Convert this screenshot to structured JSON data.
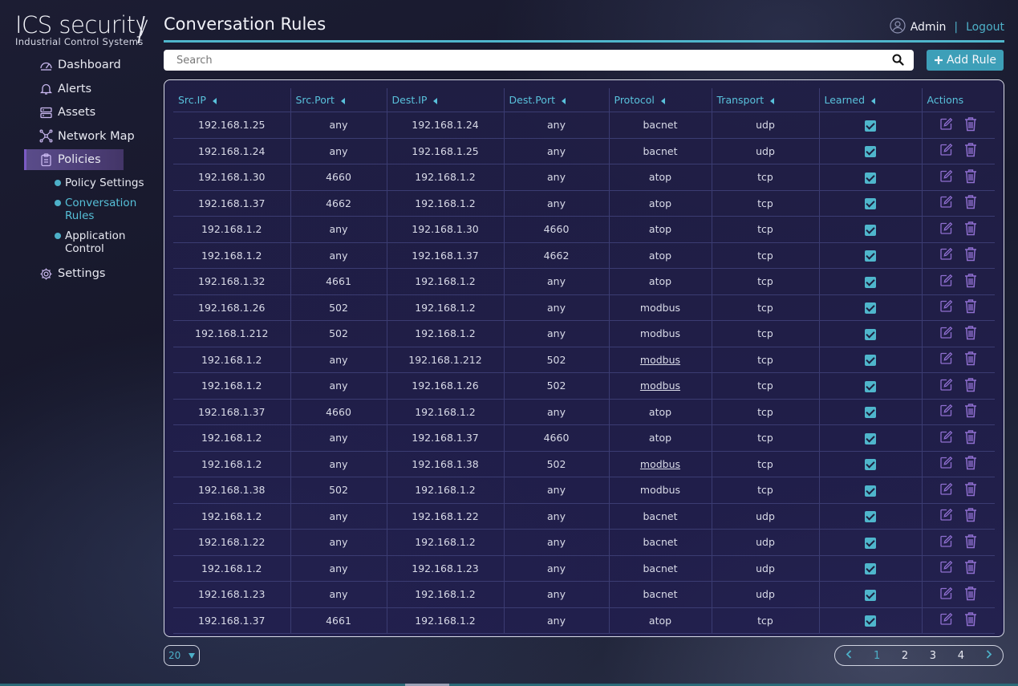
{
  "brand": {
    "name": "ICS security",
    "tagline": "Industrial Control Systems"
  },
  "sidebar": {
    "items": [
      {
        "label": "Dashboard",
        "icon": "dashboard-icon"
      },
      {
        "label": "Alerts",
        "icon": "bell-icon"
      },
      {
        "label": "Assets",
        "icon": "server-icon"
      },
      {
        "label": "Network Map",
        "icon": "network-icon"
      },
      {
        "label": "Policies",
        "icon": "clipboard-icon",
        "active": true
      },
      {
        "label": "Settings",
        "icon": "gear-icon"
      }
    ],
    "policy_subitems": [
      {
        "label": "Policy Settings"
      },
      {
        "label": "Conversation Rules",
        "active": true
      },
      {
        "label": "Application Control"
      }
    ]
  },
  "header": {
    "title": "Conversation Rules",
    "user": "Admin",
    "separator": "|",
    "logout": "Logout"
  },
  "search": {
    "placeholder": "Search"
  },
  "toolbar": {
    "add_label": "Add Rule"
  },
  "table": {
    "columns": [
      "Src.IP",
      "Src.Port",
      "Dest.IP",
      "Dest.Port",
      "Protocol",
      "Transport",
      "Learned",
      "Actions"
    ],
    "rows": [
      {
        "src_ip": "192.168.1.25",
        "src_port": "any",
        "dest_ip": "192.168.1.24",
        "dest_port": "any",
        "protocol": "bacnet",
        "transport": "udp",
        "learned": true
      },
      {
        "src_ip": "192.168.1.24",
        "src_port": "any",
        "dest_ip": "192.168.1.25",
        "dest_port": "any",
        "protocol": "bacnet",
        "transport": "udp",
        "learned": true
      },
      {
        "src_ip": "192.168.1.30",
        "src_port": "4660",
        "dest_ip": "192.168.1.2",
        "dest_port": "any",
        "protocol": "atop",
        "transport": "tcp",
        "learned": true
      },
      {
        "src_ip": "192.168.1.37",
        "src_port": "4662",
        "dest_ip": "192.168.1.2",
        "dest_port": "any",
        "protocol": "atop",
        "transport": "tcp",
        "learned": true
      },
      {
        "src_ip": "192.168.1.2",
        "src_port": "any",
        "dest_ip": "192.168.1.30",
        "dest_port": "4660",
        "protocol": "atop",
        "transport": "tcp",
        "learned": true
      },
      {
        "src_ip": "192.168.1.2",
        "src_port": "any",
        "dest_ip": "192.168.1.37",
        "dest_port": "4662",
        "protocol": "atop",
        "transport": "tcp",
        "learned": true
      },
      {
        "src_ip": "192.168.1.32",
        "src_port": "4661",
        "dest_ip": "192.168.1.2",
        "dest_port": "any",
        "protocol": "atop",
        "transport": "tcp",
        "learned": true
      },
      {
        "src_ip": "192.168.1.26",
        "src_port": "502",
        "dest_ip": "192.168.1.2",
        "dest_port": "any",
        "protocol": "modbus",
        "transport": "tcp",
        "learned": true
      },
      {
        "src_ip": "192.168.1.212",
        "src_port": "502",
        "dest_ip": "192.168.1.2",
        "dest_port": "any",
        "protocol": "modbus",
        "transport": "tcp",
        "learned": true
      },
      {
        "src_ip": "192.168.1.2",
        "src_port": "any",
        "dest_ip": "192.168.1.212",
        "dest_port": "502",
        "protocol": "modbus",
        "protocol_link": true,
        "transport": "tcp",
        "learned": true
      },
      {
        "src_ip": "192.168.1.2",
        "src_port": "any",
        "dest_ip": "192.168.1.26",
        "dest_port": "502",
        "protocol": "modbus",
        "protocol_link": true,
        "transport": "tcp",
        "learned": true
      },
      {
        "src_ip": "192.168.1.37",
        "src_port": "4660",
        "dest_ip": "192.168.1.2",
        "dest_port": "any",
        "protocol": "atop",
        "transport": "tcp",
        "learned": true
      },
      {
        "src_ip": "192.168.1.2",
        "src_port": "any",
        "dest_ip": "192.168.1.37",
        "dest_port": "4660",
        "protocol": "atop",
        "transport": "tcp",
        "learned": true
      },
      {
        "src_ip": "192.168.1.2",
        "src_port": "any",
        "dest_ip": "192.168.1.38",
        "dest_port": "502",
        "protocol": "modbus",
        "protocol_link": true,
        "transport": "tcp",
        "learned": true
      },
      {
        "src_ip": "192.168.1.38",
        "src_port": "502",
        "dest_ip": "192.168.1.2",
        "dest_port": "any",
        "protocol": "modbus",
        "transport": "tcp",
        "learned": true
      },
      {
        "src_ip": "192.168.1.2",
        "src_port": "any",
        "dest_ip": "192.168.1.22",
        "dest_port": "any",
        "protocol": "bacnet",
        "transport": "udp",
        "learned": true
      },
      {
        "src_ip": "192.168.1.22",
        "src_port": "any",
        "dest_ip": "192.168.1.2",
        "dest_port": "any",
        "protocol": "bacnet",
        "transport": "udp",
        "learned": true
      },
      {
        "src_ip": "192.168.1.2",
        "src_port": "any",
        "dest_ip": "192.168.1.23",
        "dest_port": "any",
        "protocol": "bacnet",
        "transport": "udp",
        "learned": true
      },
      {
        "src_ip": "192.168.1.23",
        "src_port": "any",
        "dest_ip": "192.168.1.2",
        "dest_port": "any",
        "protocol": "bacnet",
        "transport": "udp",
        "learned": true
      },
      {
        "src_ip": "192.168.1.37",
        "src_port": "4661",
        "dest_ip": "192.168.1.2",
        "dest_port": "any",
        "protocol": "atop",
        "transport": "tcp",
        "learned": true
      }
    ]
  },
  "pagination": {
    "page_size": "20",
    "pages": [
      "1",
      "2",
      "3",
      "4"
    ],
    "current": "1"
  },
  "colors": {
    "accent": "#4db0c8",
    "active_nav": "#5a4c8a",
    "action_icon": "#8f6fd0"
  }
}
